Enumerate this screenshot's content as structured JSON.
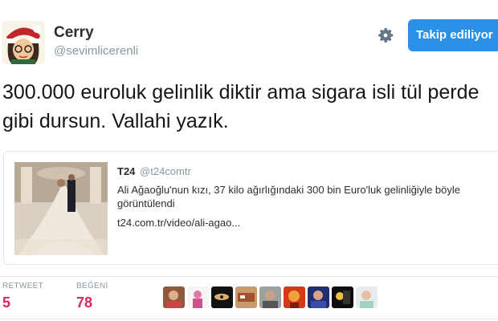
{
  "user": {
    "name": "Cerry",
    "handle": "@sevimlicerenli",
    "follow_label": "Takip ediliyor"
  },
  "tweet": {
    "text": "300.000 euroluk gelinlik diktir ama  sigara isli tül perde gibi dursun. Vallahi yazık."
  },
  "card": {
    "source_name": "T24",
    "source_handle": "@t24comtr",
    "description": "Ali Ağaoğlu'nun kızı, 37 kilo ağırlığındaki 300 bin Euro'luk gelinliğiyle böyle görüntülendi",
    "link": "t24.com.tr/video/ali-agao..."
  },
  "stats": {
    "retweet_label": "RETWEET",
    "retweet_count": "5",
    "like_label": "BEĞENİ",
    "like_count": "78"
  },
  "colors": {
    "accent": "#2b91e8",
    "like": "#e0245e",
    "muted": "#8899a6"
  },
  "icons": [
    "avatar",
    "gear-icon"
  ]
}
